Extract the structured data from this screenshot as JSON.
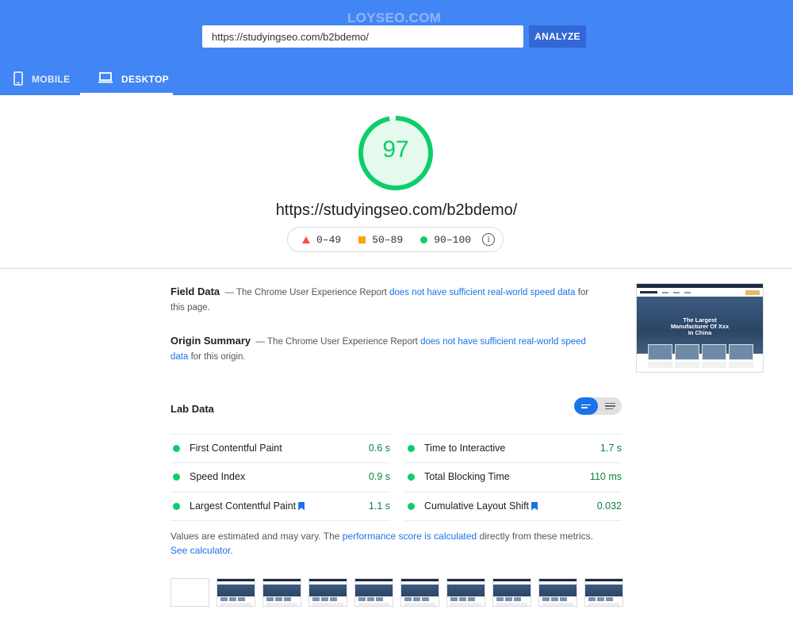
{
  "header": {
    "watermark": "LOYSEO.COM",
    "url_input_value": "https://studyingseo.com/b2bdemo/",
    "analyze_label": "ANALYZE",
    "tabs": [
      {
        "label": "MOBILE",
        "icon": "phone-icon",
        "active": false
      },
      {
        "label": "DESKTOP",
        "icon": "laptop-icon",
        "active": true
      }
    ]
  },
  "score": {
    "value": "97",
    "value_fraction": 0.97,
    "url": "https://studyingseo.com/b2bdemo/",
    "legend": [
      {
        "range": "0–49",
        "shape": "triangle",
        "color": "#ff4e42"
      },
      {
        "range": "50–89",
        "shape": "square",
        "color": "#ffa400"
      },
      {
        "range": "90–100",
        "shape": "circle",
        "color": "#0cce6b"
      }
    ]
  },
  "field_data": {
    "title": "Field Data",
    "dash": "—",
    "text_before": "The Chrome User Experience Report",
    "link": "does not have sufficient real-world speed data",
    "text_after": "for this page."
  },
  "origin_summary": {
    "title": "Origin Summary",
    "dash": "—",
    "text_before": "The Chrome User Experience Report",
    "link": "does not have sufficient real-world speed data",
    "text_after": "for this origin."
  },
  "thumbnail": {
    "logo": "LOYSEO.COM",
    "hero_line1": "The Largest",
    "hero_line2": "Manufacturer Of Xxx",
    "hero_line3": "In China"
  },
  "lab_data": {
    "title": "Lab Data",
    "metrics_left": [
      {
        "name": "First Contentful Paint",
        "value": "0.6 s",
        "bookmark": false
      },
      {
        "name": "Speed Index",
        "value": "0.9 s",
        "bookmark": false
      },
      {
        "name": "Largest Contentful Paint",
        "value": "1.1 s",
        "bookmark": true
      }
    ],
    "metrics_right": [
      {
        "name": "Time to Interactive",
        "value": "1.7 s",
        "bookmark": false
      },
      {
        "name": "Total Blocking Time",
        "value": "110 ms",
        "bookmark": false
      },
      {
        "name": "Cumulative Layout Shift",
        "value": "0.032",
        "bookmark": true
      }
    ]
  },
  "note": {
    "text1": "Values are estimated and may vary. The",
    "link1": "performance score is calculated",
    "text2": "directly from these metrics.",
    "link2": "See calculator."
  },
  "colors": {
    "header_bg": "#4285f4",
    "analyze_bg": "#3367d6",
    "pass": "#0cce6b",
    "average": "#ffa400",
    "fail": "#ff4e42",
    "link": "#1a73e8"
  }
}
